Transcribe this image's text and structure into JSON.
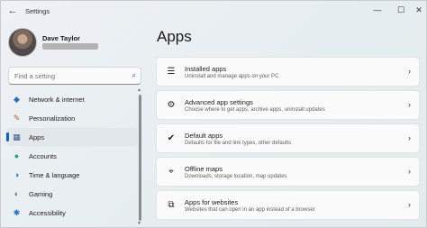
{
  "window": {
    "title": "Settings",
    "back_glyph": "←",
    "minimize_glyph": "—",
    "maximize_glyph": "☐",
    "close_glyph": "✕"
  },
  "profile": {
    "name": "Dave Taylor"
  },
  "search": {
    "placeholder": "Find a setting",
    "icon": "search-icon",
    "glyph": "⌕"
  },
  "nav": {
    "items": [
      {
        "label": "Network & internet",
        "icon": "wifi-icon",
        "glyph": "◆",
        "color": "#1a73c7",
        "selected": false
      },
      {
        "label": "Personalization",
        "icon": "brush-icon",
        "glyph": "✎",
        "color": "#b5651d",
        "selected": false
      },
      {
        "label": "Apps",
        "icon": "apps-icon",
        "glyph": "▦",
        "color": "#3a5a8c",
        "selected": true
      },
      {
        "label": "Accounts",
        "icon": "accounts-icon",
        "glyph": "●",
        "color": "#2a9d8f",
        "selected": false
      },
      {
        "label": "Time & language",
        "icon": "globe-clock-icon",
        "glyph": "◑",
        "color": "#1a73c7",
        "selected": false
      },
      {
        "label": "Gaming",
        "icon": "gamepad-icon",
        "glyph": "◐",
        "color": "#666666",
        "selected": false
      },
      {
        "label": "Accessibility",
        "icon": "accessibility-icon",
        "glyph": "✱",
        "color": "#1a73c7",
        "selected": false
      }
    ],
    "scroll_up_glyph": "▲",
    "scroll_down_glyph": "▼"
  },
  "main": {
    "title": "Apps",
    "cards": [
      {
        "title": "Installed apps",
        "subtitle": "Uninstall and manage apps on your PC",
        "icon": "installed-apps-icon",
        "glyph": "☰"
      },
      {
        "title": "Advanced app settings",
        "subtitle": "Choose where to get apps, archive apps, uninstall updates",
        "icon": "advanced-app-settings-icon",
        "glyph": "⚙"
      },
      {
        "title": "Default apps",
        "subtitle": "Defaults for file and link types, other defaults",
        "icon": "default-apps-icon",
        "glyph": "✔"
      },
      {
        "title": "Offline maps",
        "subtitle": "Downloads, storage location, map updates",
        "icon": "map-icon",
        "glyph": "⌖"
      },
      {
        "title": "Apps for websites",
        "subtitle": "Websites that can open in an app instead of a browser",
        "icon": "link-icon",
        "glyph": "⧉"
      }
    ],
    "chevron_glyph": "›"
  }
}
